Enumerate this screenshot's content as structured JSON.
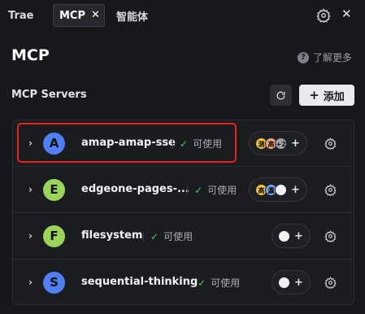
{
  "tabs": {
    "trae": "Trae",
    "mcp": "MCP",
    "close": "✕",
    "agent": "智能体"
  },
  "header": {
    "title": "MCP",
    "learn_more": "了解更多",
    "help_glyph": "?"
  },
  "section": {
    "label": "MCP Servers",
    "add_label": "添加",
    "add_plus": "+"
  },
  "status_check": "✓",
  "chevron": "›",
  "servers": [
    {
      "initial": "A",
      "avatar_color": "#4f7ff0",
      "name": "amap-amap-sse",
      "status": "可使用",
      "clients": [
        {
          "label": "测",
          "color": "#f0c43c"
        },
        {
          "label": "高",
          "color": "#f0a07a"
        },
        {
          "label": "+2",
          "color": "#9ea1a8"
        }
      ]
    },
    {
      "initial": "E",
      "avatar_color": "#9ad45a",
      "name": "edgeone-pages-...",
      "status": "可使用",
      "clients": [
        {
          "label": "高",
          "color": "#f0c43c"
        },
        {
          "label": "瀛",
          "color": "#7aa0f0"
        },
        {
          "label": "",
          "color": "#f1f1f3"
        }
      ]
    },
    {
      "initial": "F",
      "avatar_color": "#9ad45a",
      "name": "filesystem",
      "status": "可使用",
      "clients": [
        {
          "label": "",
          "color": "#f1f1f3"
        }
      ]
    },
    {
      "initial": "S",
      "avatar_color": "#4f7ff0",
      "name": "sequential-thinking",
      "status": "可使用",
      "clients": [
        {
          "label": "",
          "color": "#f1f1f3"
        }
      ]
    }
  ],
  "client_add": "+"
}
